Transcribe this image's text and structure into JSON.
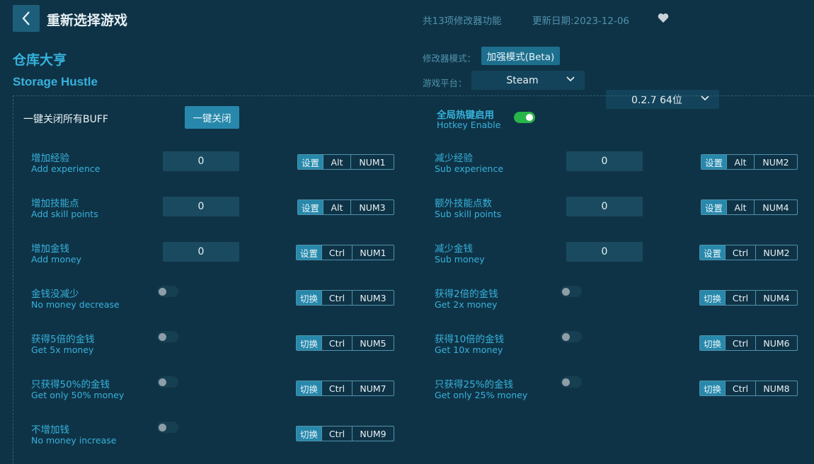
{
  "header": {
    "back_title": "重新选择游戏",
    "feature_count": "共13项修改器功能",
    "update_date": "更新日期:2023-12-06"
  },
  "game": {
    "title_cn": "仓库大亨",
    "title_en": "Storage Hustle"
  },
  "settings": {
    "mode_label": "修改器模式：",
    "mode_value": "加强模式(Beta)",
    "platform_label": "游戏平台：",
    "platform_value": "Steam",
    "version_value": "0.2.7 64位"
  },
  "global": {
    "close_all_label": "一键关闭所有BUFF",
    "close_all_button": "一键关闭",
    "hotkey_cn": "全局热键启用",
    "hotkey_en": "Hotkey Enable",
    "hotkey_enabled": true
  },
  "colors": {
    "background": "#0f3346",
    "accent": "#36b2dc",
    "button": "#2788ab",
    "toggle_on": "#28b54a"
  },
  "features": [
    {
      "cn": "增加经验",
      "en": "Add experience",
      "type": "input",
      "value": "0",
      "action": "设置",
      "mod": "Alt",
      "key": "NUM1"
    },
    {
      "cn": "减少经验",
      "en": "Sub experience",
      "type": "input",
      "value": "0",
      "action": "设置",
      "mod": "Alt",
      "key": "NUM2"
    },
    {
      "cn": "增加技能点",
      "en": "Add skill points",
      "type": "input",
      "value": "0",
      "action": "设置",
      "mod": "Alt",
      "key": "NUM3"
    },
    {
      "cn": "额外技能点数",
      "en": "Sub skill points",
      "type": "input",
      "value": "0",
      "action": "设置",
      "mod": "Alt",
      "key": "NUM4"
    },
    {
      "cn": "增加金钱",
      "en": "Add money",
      "type": "input",
      "value": "0",
      "action": "设置",
      "mod": "Ctrl",
      "key": "NUM1"
    },
    {
      "cn": "减少金钱",
      "en": "Sub money",
      "type": "input",
      "value": "0",
      "action": "设置",
      "mod": "Ctrl",
      "key": "NUM2"
    },
    {
      "cn": "金钱没减少",
      "en": "No money decrease",
      "type": "toggle",
      "on": false,
      "action": "切换",
      "mod": "Ctrl",
      "key": "NUM3"
    },
    {
      "cn": "获得2倍的金钱",
      "en": "Get 2x money",
      "type": "toggle",
      "on": false,
      "action": "切换",
      "mod": "Ctrl",
      "key": "NUM4"
    },
    {
      "cn": "获得5倍的金钱",
      "en": "Get 5x money",
      "type": "toggle",
      "on": false,
      "action": "切换",
      "mod": "Ctrl",
      "key": "NUM5"
    },
    {
      "cn": "获得10倍的金钱",
      "en": "Get 10x money",
      "type": "toggle",
      "on": false,
      "action": "切换",
      "mod": "Ctrl",
      "key": "NUM6"
    },
    {
      "cn": "只获得50%的金钱",
      "en": "Get only 50% money",
      "type": "toggle",
      "on": false,
      "action": "切换",
      "mod": "Ctrl",
      "key": "NUM7"
    },
    {
      "cn": "只获得25%的金钱",
      "en": "Get only 25% money",
      "type": "toggle",
      "on": false,
      "action": "切换",
      "mod": "Ctrl",
      "key": "NUM8"
    },
    {
      "cn": "不增加钱",
      "en": "No money increase",
      "type": "toggle",
      "on": false,
      "action": "切换",
      "mod": "Ctrl",
      "key": "NUM9"
    }
  ]
}
